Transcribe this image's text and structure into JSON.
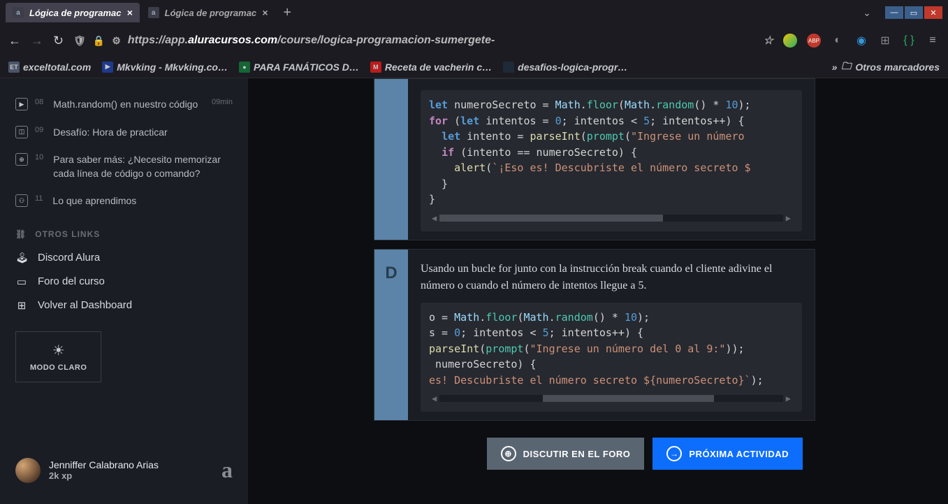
{
  "browser": {
    "tabs": [
      {
        "title": "Lógica de programac",
        "active": true
      },
      {
        "title": "Lógica de programac",
        "active": false
      }
    ],
    "url_prefix": "https://app.",
    "url_domain": "aluracursos.com",
    "url_path": "/course/logica-programacion-sumergete-",
    "bookmarks": [
      {
        "label": "exceltotal.com",
        "fav": "ET",
        "favbg": "#4a5568"
      },
      {
        "label": "Mkvking - Mkvking.co…",
        "fav": "▶",
        "favbg": "#1e3a8a"
      },
      {
        "label": "PARA FANÁTICOS D…",
        "fav": "●",
        "favbg": "#166534"
      },
      {
        "label": "Receta de vacherin c…",
        "fav": "M",
        "favbg": "#b91c1c"
      },
      {
        "label": "desafios-logica-progr…",
        "fav": "",
        "favbg": "#1f2937"
      }
    ],
    "other_bookmarks": "Otros marcadores"
  },
  "sidebar": {
    "lessons": [
      {
        "num": "08",
        "title": "Math.random() en nuestro código",
        "duration": "09min",
        "icon": "play"
      },
      {
        "num": "09",
        "title": "Desafío: Hora de practicar",
        "duration": "",
        "icon": "doc"
      },
      {
        "num": "10",
        "title": "Para saber más: ¿Necesito memorizar cada línea de código o comando?",
        "duration": "",
        "icon": "plus"
      },
      {
        "num": "11",
        "title": "Lo que aprendimos",
        "duration": "",
        "icon": "people"
      }
    ],
    "section_title": "OTROS LINKS",
    "links": [
      {
        "label": "Discord Alura",
        "icon": "discord"
      },
      {
        "label": "Foro del curso",
        "icon": "forum"
      },
      {
        "label": "Volver al Dashboard",
        "icon": "dashboard"
      }
    ],
    "theme_label": "MODO CLARO",
    "user": {
      "name": "Jenniffer Calabrano Arias",
      "xp": "2k xp"
    }
  },
  "content": {
    "answer_c": {
      "code_lines": [
        [
          [
            "kw-let",
            "let"
          ],
          [
            "id",
            " numeroSecreto = "
          ],
          [
            "obj",
            "Math"
          ],
          [
            "op",
            "."
          ],
          [
            "fn",
            "floor"
          ],
          [
            "op",
            "("
          ],
          [
            "obj",
            "Math"
          ],
          [
            "op",
            "."
          ],
          [
            "fn",
            "random"
          ],
          [
            "op",
            "() * "
          ],
          [
            "num-b",
            "10"
          ],
          [
            "op",
            ");"
          ]
        ],
        [
          [
            "kw-for",
            "for"
          ],
          [
            "op",
            " ("
          ],
          [
            "kw-let",
            "let"
          ],
          [
            "id",
            " intentos = "
          ],
          [
            "num-b",
            "0"
          ],
          [
            "op",
            "; intentos < "
          ],
          [
            "num-b",
            "5"
          ],
          [
            "op",
            "; intentos++) {"
          ]
        ],
        [
          [
            "op",
            "  "
          ],
          [
            "kw-let",
            "let"
          ],
          [
            "id",
            " intento = "
          ],
          [
            "fn2",
            "parseInt"
          ],
          [
            "op",
            "("
          ],
          [
            "fn",
            "prompt"
          ],
          [
            "op",
            "("
          ],
          [
            "str",
            "\"Ingrese un número "
          ]
        ],
        [
          [
            "op",
            "  "
          ],
          [
            "kw-if",
            "if"
          ],
          [
            "op",
            " (intento == numeroSecreto) {"
          ]
        ],
        [
          [
            "op",
            "    "
          ],
          [
            "fn2",
            "alert"
          ],
          [
            "op",
            "("
          ],
          [
            "str",
            "`¡Eso es! Descubriste el número secreto $"
          ]
        ],
        [
          [
            "op",
            "  }"
          ]
        ],
        [
          [
            "op",
            "}"
          ]
        ]
      ]
    },
    "answer_d": {
      "letter": "D",
      "text": "Usando un bucle for junto con la instrucción break cuando el cliente adivine el número o cuando el número de intentos llegue a 5.",
      "code_lines": [
        [
          [
            "id",
            "o = "
          ],
          [
            "obj",
            "Math"
          ],
          [
            "op",
            "."
          ],
          [
            "fn",
            "floor"
          ],
          [
            "op",
            "("
          ],
          [
            "obj",
            "Math"
          ],
          [
            "op",
            "."
          ],
          [
            "fn",
            "random"
          ],
          [
            "op",
            "() * "
          ],
          [
            "num-b",
            "10"
          ],
          [
            "op",
            ");"
          ]
        ],
        [
          [
            "id",
            "s = "
          ],
          [
            "num-b",
            "0"
          ],
          [
            "op",
            "; intentos < "
          ],
          [
            "num-b",
            "5"
          ],
          [
            "op",
            "; intentos++) {"
          ]
        ],
        [
          [
            "fn2",
            "parseInt"
          ],
          [
            "op",
            "("
          ],
          [
            "fn",
            "prompt"
          ],
          [
            "op",
            "("
          ],
          [
            "str",
            "\"Ingrese un número del 0 al 9:\""
          ],
          [
            "op",
            "));"
          ]
        ],
        [
          [
            "id",
            " numeroSecreto) {"
          ]
        ],
        [
          [
            "str",
            "es! Descubriste el número secreto ${numeroSecreto}`"
          ],
          [
            "op",
            ");"
          ]
        ]
      ]
    },
    "forum_btn": "DISCUTIR EN EL FORO",
    "next_btn": "PRÓXIMA ACTIVIDAD"
  }
}
